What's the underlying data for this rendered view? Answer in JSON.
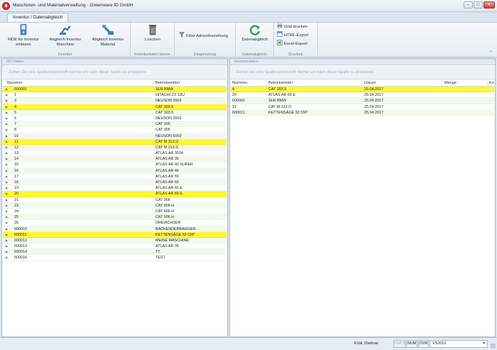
{
  "window": {
    "title": "Maschinen- und Materialverwaltung - Greenware ID GmbH",
    "controls": {
      "minimize": "–",
      "maximize": "□",
      "close": "✕"
    }
  },
  "tabs": [
    {
      "label": "Inventur / Datenabgleich",
      "active": true
    }
  ],
  "ribbon": {
    "groups": [
      {
        "label": "Inventur",
        "buttons": [
          {
            "label": "MDE für Inventur einlesen",
            "icon": "mobile-device-icon"
          },
          {
            "label": "Abgleich Inventur Maschine",
            "icon": "machine-sync-icon"
          },
          {
            "label": "Abgleich Inventur Material",
            "icon": "material-sync-icon"
          }
        ]
      },
      {
        "label": "Inventurdaten leeren",
        "buttons": [
          {
            "label": "Löschen",
            "icon": "trash-icon"
          }
        ]
      },
      {
        "label": "Eingrenzung",
        "buttons": [
          {
            "label": "Filter Adressbeziehung",
            "icon": "filter-icon"
          }
        ]
      },
      {
        "label": "Datenabgleich",
        "buttons": [
          {
            "label": "Datenabgleich",
            "icon": "refresh-icon"
          }
        ]
      },
      {
        "label": "Drucken",
        "buttons": [
          {
            "label": "Grid drucken",
            "icon": "print-icon"
          },
          {
            "label": "HTML-Export",
            "icon": "html-export-icon"
          },
          {
            "label": "Excel-Export",
            "icon": "excel-export-icon"
          }
        ]
      }
    ],
    "collapse": "⌃"
  },
  "ist_panel": {
    "caption": "IST-Daten",
    "group_hint": "Ziehen Sie eine Spaltenüberschrift hierher um nach dieser Spalte zu gruppieren",
    "columns": [
      "Nummer",
      "Betriebsmittel"
    ],
    "rows": [
      {
        "nummer": "600001",
        "betriebsmittel": "1ER BMW",
        "highlight": true
      },
      {
        "nummer": "1",
        "betriebsmittel": "HITACHI ZX 10U",
        "highlight": false
      },
      {
        "nummer": "3",
        "betriebsmittel": "NEUSON 3503",
        "highlight": false
      },
      {
        "nummer": "4",
        "betriebsmittel": "CAT 303.5",
        "highlight": true
      },
      {
        "nummer": "5",
        "betriebsmittel": "CAT 303.5",
        "highlight": false
      },
      {
        "nummer": "6",
        "betriebsmittel": "NEUSON 3503",
        "highlight": false
      },
      {
        "nummer": "7",
        "betriebsmittel": "CAT 305",
        "highlight": false
      },
      {
        "nummer": "8",
        "betriebsmittel": "CAT 305",
        "highlight": false
      },
      {
        "nummer": "10",
        "betriebsmittel": "NEUSON 6003",
        "highlight": false
      },
      {
        "nummer": "11",
        "betriebsmittel": "CAT M 313 D",
        "highlight": true
      },
      {
        "nummer": "12",
        "betriebsmittel": "CAT M 313 D",
        "highlight": false
      },
      {
        "nummer": "13",
        "betriebsmittel": "ATLAS AR 3534",
        "highlight": false
      },
      {
        "nummer": "14",
        "betriebsmittel": "ATLAS AR 35",
        "highlight": false
      },
      {
        "nummer": "15",
        "betriebsmittel": "ATLAS AR 40 SUPER",
        "highlight": false
      },
      {
        "nummer": "16",
        "betriebsmittel": "ATLAS AR 46",
        "highlight": false
      },
      {
        "nummer": "17",
        "betriebsmittel": "ATLAS AR 55",
        "highlight": false
      },
      {
        "nummer": "18",
        "betriebsmittel": "ATLAS AR 65",
        "highlight": false
      },
      {
        "nummer": "19",
        "betriebsmittel": "ATLAS AR 65 E",
        "highlight": false
      },
      {
        "nummer": "20",
        "betriebsmittel": "ATLAS AR 65 E",
        "highlight": true
      },
      {
        "nummer": "21",
        "betriebsmittel": "CAT 906",
        "highlight": false
      },
      {
        "nummer": "23",
        "betriebsmittel": "CAT 906 H",
        "highlight": false
      },
      {
        "nummer": "24",
        "betriebsmittel": "CAT 906 H",
        "highlight": false
      },
      {
        "nummer": "25",
        "betriebsmittel": "CAT 906 H",
        "highlight": false
      },
      {
        "nummer": "26",
        "betriebsmittel": "DREIACHSER",
        "highlight": false
      },
      {
        "nummer": "600010",
        "betriebsmittel": "BACKENDERBAGGER",
        "highlight": false
      },
      {
        "nummer": "600011",
        "betriebsmittel": "KETTENSÄGE 32 CM³",
        "highlight": true
      },
      {
        "nummer": "600012",
        "betriebsmittel": "MEINE MASCHINE",
        "highlight": false
      },
      {
        "nummer": "600013",
        "betriebsmittel": "ATLAS AR 35",
        "highlight": false
      },
      {
        "nummer": "600014",
        "betriebsmittel": "TT",
        "highlight": false
      },
      {
        "nummer": "600016",
        "betriebsmittel": "TEST",
        "highlight": false
      }
    ]
  },
  "inventur_panel": {
    "caption": "Inventurdaten",
    "group_hint": "Ziehen Sie eine Spaltenüberschrift hierher um nach dieser Spalte zu gruppieren",
    "columns": [
      "Nummer",
      "Betriebsmittel",
      "Datum",
      "Menge",
      "Ko"
    ],
    "rows": [
      {
        "nummer": "4",
        "betriebsmittel": "CAT 303.5",
        "datum": "25.04.2017",
        "menge": "",
        "highlight": true
      },
      {
        "nummer": "20",
        "betriebsmittel": "ATLAS AR 65 E",
        "datum": "25.04.2017",
        "menge": "",
        "highlight": false
      },
      {
        "nummer": "600001",
        "betriebsmittel": "1ER BMW",
        "datum": "25.04.2017",
        "menge": "",
        "highlight": false
      },
      {
        "nummer": "11",
        "betriebsmittel": "CAT M 313 D",
        "datum": "25.04.2017",
        "menge": "",
        "highlight": false
      },
      {
        "nummer": "600011",
        "betriebsmittel": "KETTENSÄGE 32 CM³",
        "datum": "25.04.2017",
        "menge": "",
        "highlight": false
      }
    ]
  },
  "statusbar": {
    "user": "Kröll, Dietmar",
    "indicators": [
      {
        "label": "CAPS",
        "active": false
      },
      {
        "label": "NUM",
        "active": true
      },
      {
        "label": "OVR",
        "active": true
      }
    ],
    "theme": "VS2010"
  },
  "colors": {
    "highlight": "#fff72f",
    "alt_row": "#f2f9ea",
    "accent": "#3f6fb5"
  }
}
